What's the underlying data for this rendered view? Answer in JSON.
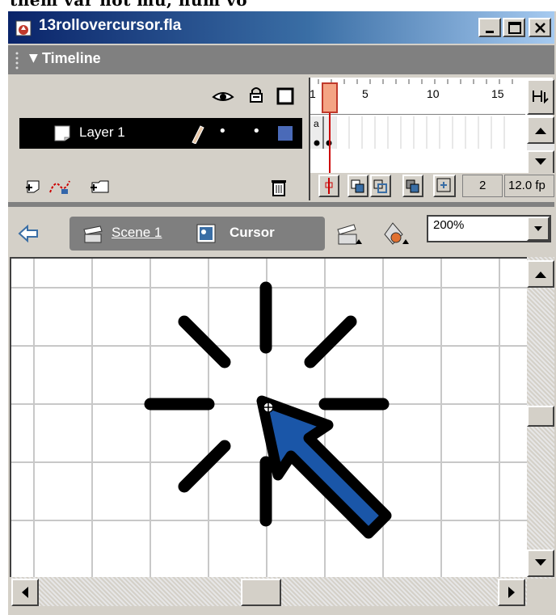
{
  "cropped_text": "tnem var not mu, num vo",
  "window": {
    "title": "13rollovercursor.fla",
    "controls": {
      "minimize": "minimize-icon",
      "maximize": "maximize-icon",
      "close": "close-icon"
    }
  },
  "timeline": {
    "label": "Timeline",
    "header_icons": [
      "eye-icon",
      "lock-icon",
      "outline-square-icon"
    ],
    "layers": [
      {
        "name": "Layer 1",
        "selected": true,
        "color": "#4a6ab8"
      }
    ],
    "ruler_numbers": [
      "1",
      "5",
      "10",
      "15"
    ],
    "current_frame": "2",
    "frame_rate": "12.0 fp",
    "keyframe_label": "a"
  },
  "nav": {
    "scene": "Scene 1",
    "symbol": "Cursor",
    "zoom": "200%"
  },
  "colors": {
    "title_gradient_start": "#0a246a",
    "title_gradient_end": "#a6caf0",
    "arrow_fill": "#1a56a8",
    "chrome": "#d4d0c8",
    "grid": "#c8c8c8"
  }
}
